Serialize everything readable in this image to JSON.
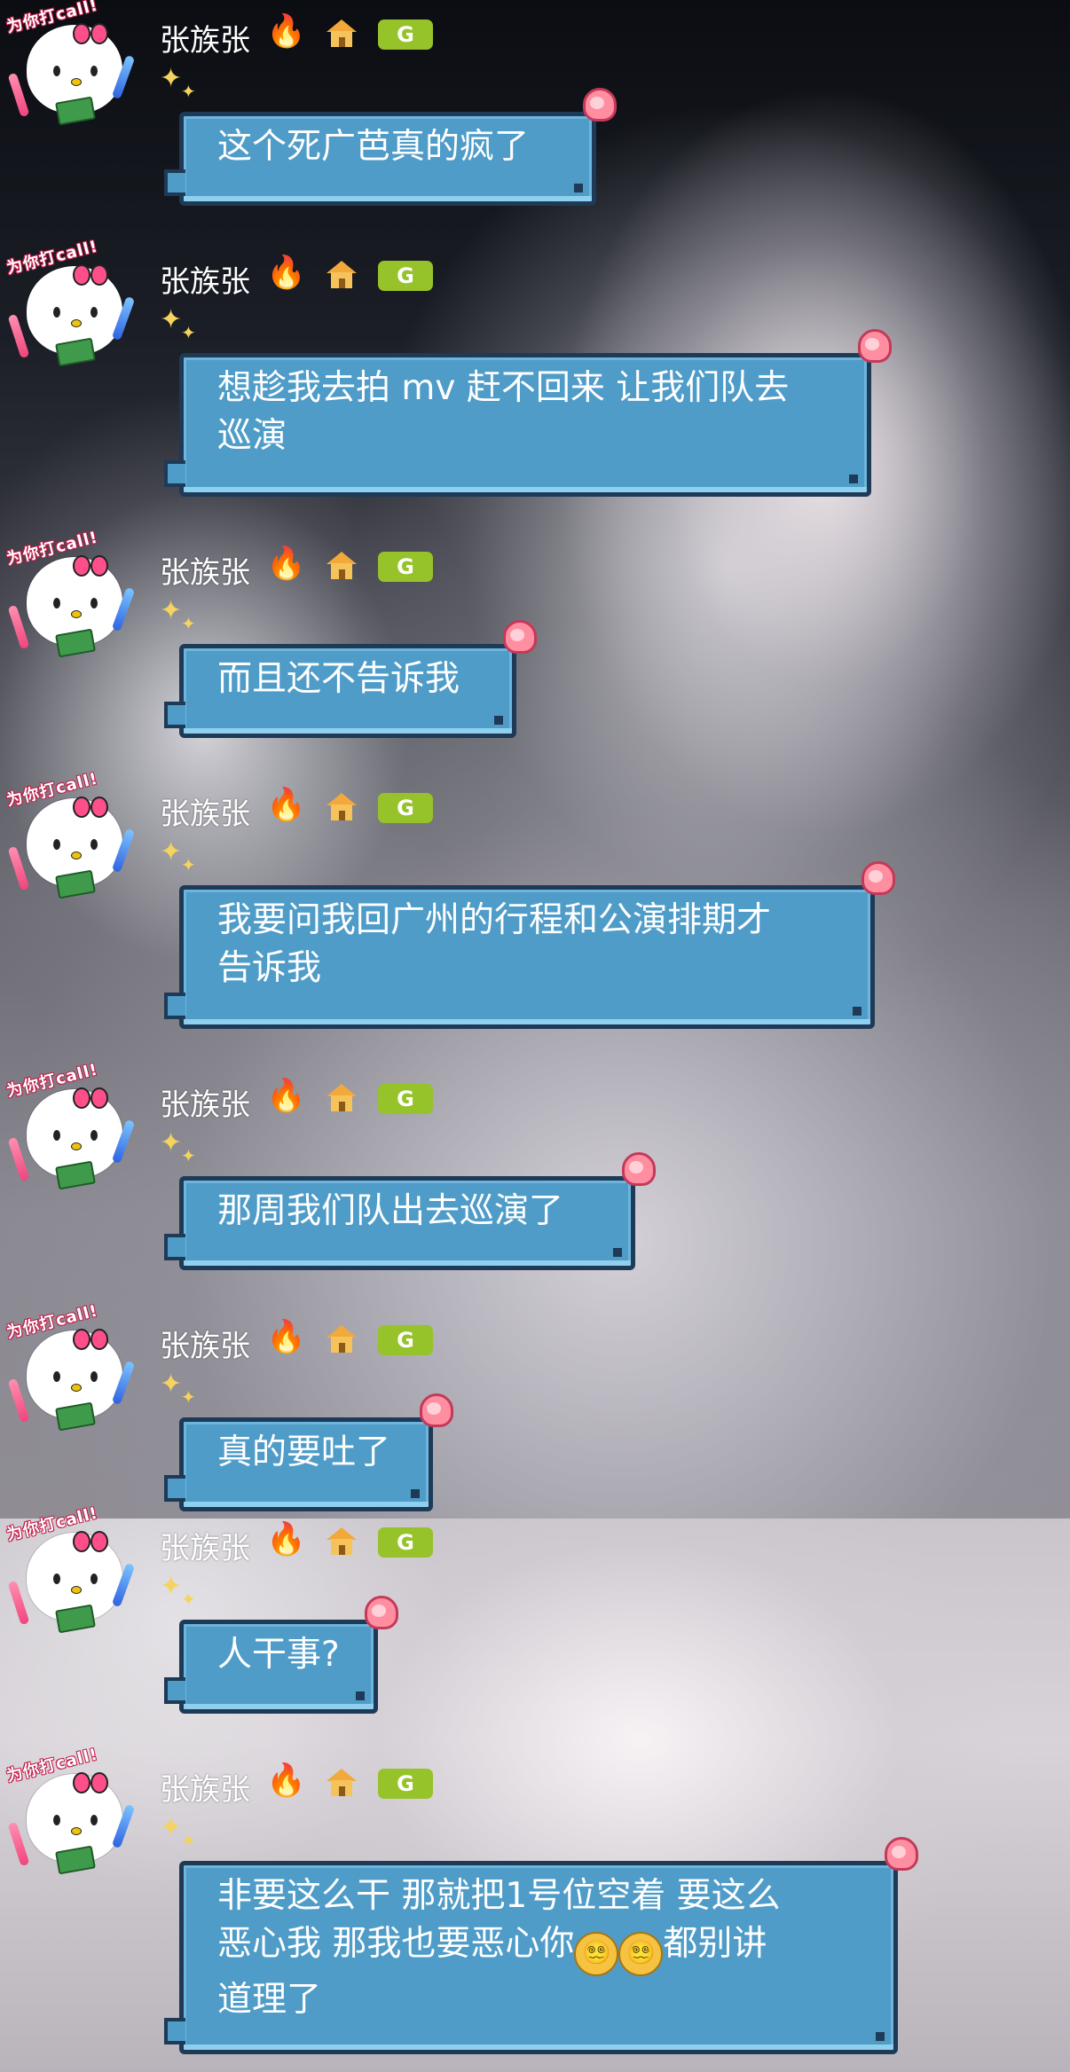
{
  "sender": {
    "name": "张族张",
    "fire_icon": "fire-icon",
    "house_icon": "house-icon",
    "badge": "G",
    "avatar_callout": "为你打call!"
  },
  "messages": [
    {
      "text": "这个死广芭真的疯了"
    },
    {
      "text": "想趁我去拍 mv 赶不回来 让我们队去\n巡演"
    },
    {
      "text": "而且还不告诉我"
    },
    {
      "text": "我要问我回广州的行程和公演排期才\n告诉我"
    },
    {
      "text": "那周我们队出去巡演了"
    },
    {
      "text": "真的要吐了"
    },
    {
      "text": "人干事?"
    },
    {
      "text_before_emoji": "非要这么干 那就把1号位空着 要这么\n恶心我 那我也要恶心你",
      "emoji_1": "😵‍💫",
      "emoji_2": "😵‍💫",
      "text_after_emoji": "都别讲\n道理了"
    }
  ],
  "colors": {
    "bubble": "#4f9cc8",
    "bubble_border": "#1e3a57",
    "badge": "#96c22a"
  }
}
